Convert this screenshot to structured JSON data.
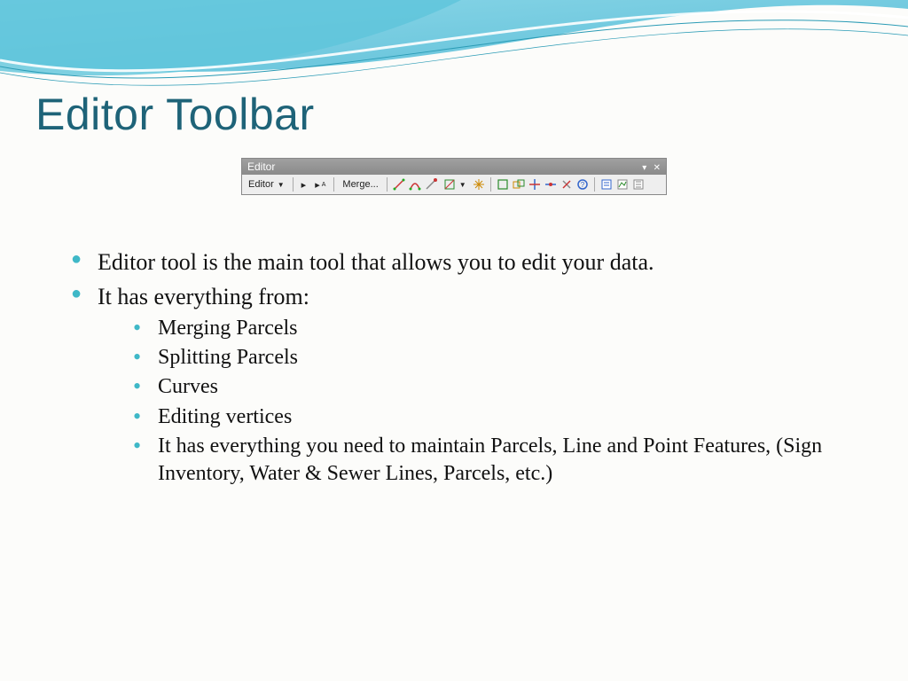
{
  "slide": {
    "title": "Editor Toolbar",
    "bullets": [
      {
        "text": "Editor tool is the main tool that allows you to edit your data."
      },
      {
        "text": "It has everything from:",
        "sub": [
          "Merging Parcels",
          "Splitting Parcels",
          "Curves",
          "Editing vertices",
          "It has everything you need to maintain Parcels, Line and Point Features, (Sign Inventory, Water & Sewer Lines, Parcels, etc.)"
        ]
      }
    ]
  },
  "toolbar": {
    "window_title": "Editor",
    "menu_label": "Editor",
    "merge_label": "Merge...",
    "icons": [
      "play-icon",
      "play-a-icon",
      "line-icon",
      "arc-icon",
      "endpoint-icon",
      "trace-icon",
      "rectangle-icon",
      "burst-icon",
      "topo1-icon",
      "topo2-icon",
      "split-icon",
      "rotate-icon",
      "cut-icon",
      "help-icon",
      "attributes-icon",
      "sketch-icon",
      "options-icon"
    ]
  },
  "colors": {
    "title": "#1e6378",
    "bullet": "#3fb8c7",
    "wave_light": "#aee1ec",
    "wave_dark": "#4cb8d4"
  }
}
